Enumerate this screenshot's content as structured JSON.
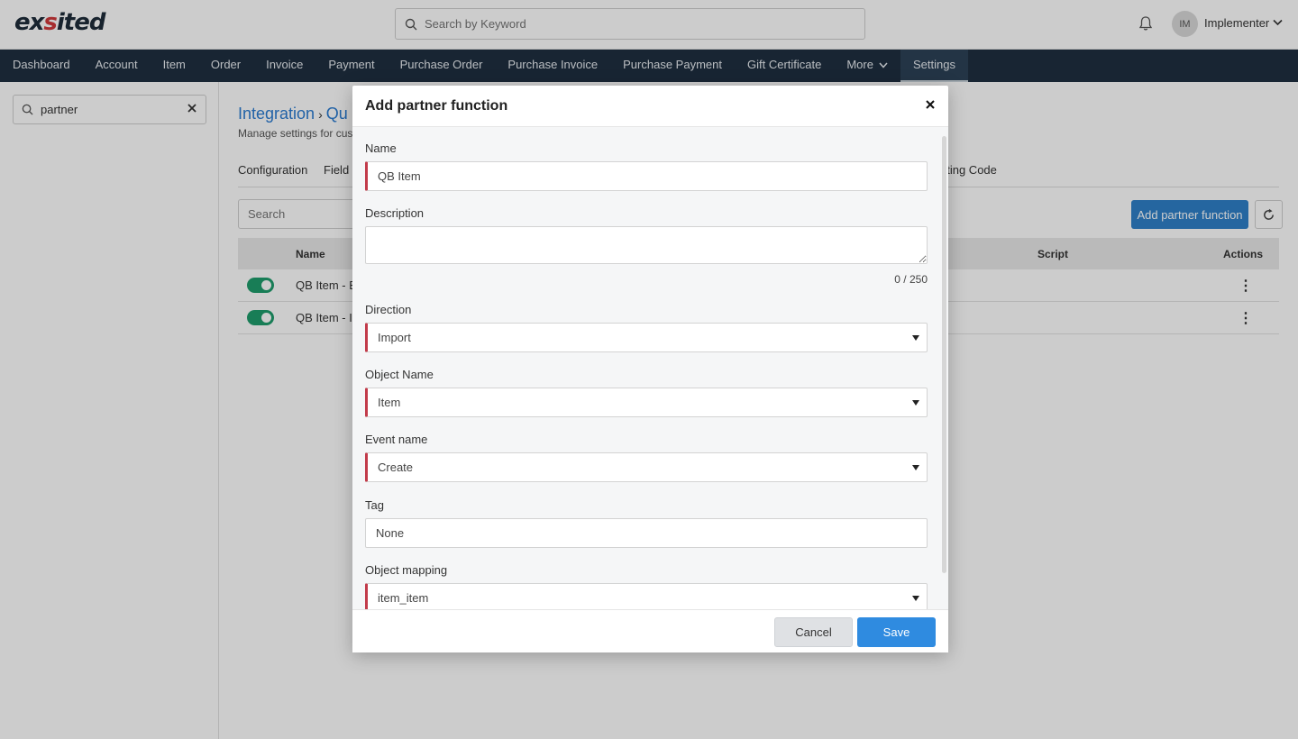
{
  "brand": {
    "logo_text_a": "ex",
    "logo_text_accent": "s",
    "logo_text_b": "ited"
  },
  "header": {
    "search_placeholder": "Search by Keyword",
    "avatar_initials": "IM",
    "user_name": "Implementer"
  },
  "nav": {
    "items": [
      "Dashboard",
      "Account",
      "Item",
      "Order",
      "Invoice",
      "Payment",
      "Purchase Order",
      "Purchase Invoice",
      "Purchase Payment",
      "Gift Certificate"
    ],
    "more_label": "More",
    "settings_label": "Settings"
  },
  "sidebar": {
    "search_value": "partner"
  },
  "main": {
    "breadcrumb_root": "Integration",
    "breadcrumb_sep": "›",
    "breadcrumb_current": "Qu",
    "subtitle": "Manage settings for cus",
    "tabs": [
      "Configuration",
      "Field S",
      "nting Code"
    ],
    "search_placeholder": "Search",
    "add_button": "Add partner function",
    "columns": {
      "name": "Name",
      "script": "Script",
      "actions": "Actions"
    },
    "rows": [
      {
        "name": "QB Item - Ex",
        "enabled": true
      },
      {
        "name": "QB Item - Im",
        "enabled": true
      }
    ],
    "kebab": "⋮"
  },
  "modal": {
    "title": "Add partner function",
    "close_glyph": "✕",
    "fields": {
      "name_label": "Name",
      "name_value": "QB Item",
      "description_label": "Description",
      "description_value": "",
      "counter": "0 / 250",
      "direction_label": "Direction",
      "direction_value": "Import",
      "object_name_label": "Object Name",
      "object_name_value": "Item",
      "event_name_label": "Event name",
      "event_name_value": "Create",
      "tag_label": "Tag",
      "tag_value": "None",
      "object_mapping_label": "Object mapping",
      "object_mapping_value": "item_item"
    },
    "cancel_label": "Cancel",
    "save_label": "Save"
  },
  "colors": {
    "nav_bg": "#1e2f40",
    "primary": "#2f80c9",
    "required_marker": "#c23b4a",
    "toggle_on": "#1f9d6c"
  },
  "icons": [
    "search-icon",
    "bell-icon",
    "chevron-down-icon",
    "clear-icon",
    "refresh-icon",
    "close-icon",
    "kebab-icon",
    "caret-down-icon"
  ]
}
